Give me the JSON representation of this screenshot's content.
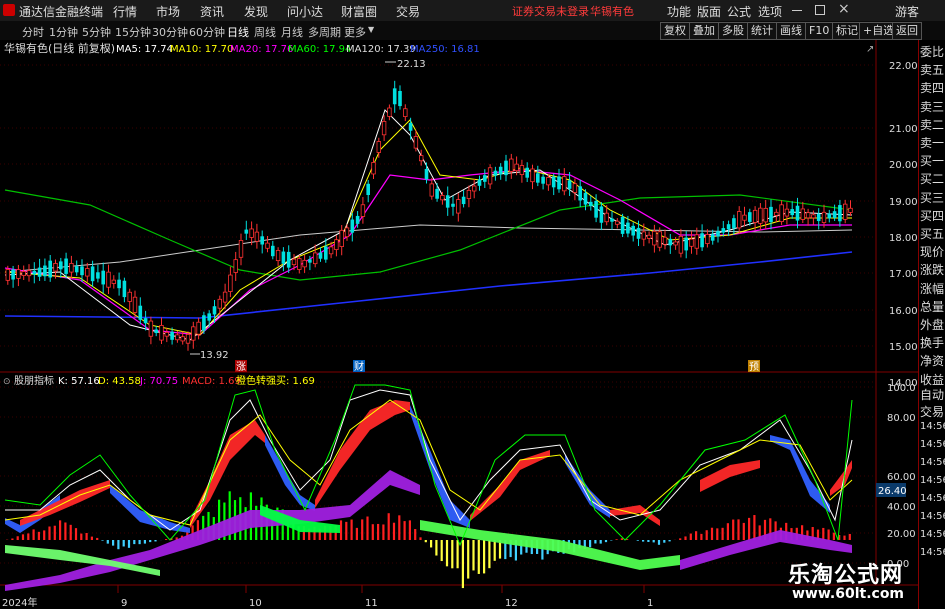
{
  "topbar": {
    "app_title": "通达信金融终端",
    "menu": [
      "行情",
      "市场",
      "资讯",
      "发现",
      "问小达",
      "财富圈",
      "交易"
    ],
    "warning": "证券交易未登录",
    "stock_name": "华锡有色",
    "right_menu": [
      "功能",
      "版面",
      "公式",
      "选项"
    ],
    "guest": "游客"
  },
  "timeframes": {
    "items": [
      "分时",
      "1分钟",
      "5分钟",
      "15分钟",
      "30分钟",
      "60分钟",
      "日线",
      "周线",
      "月线",
      "多周期",
      "更多"
    ],
    "active": "日线"
  },
  "toolbar": {
    "buttons": [
      "复权",
      "叠加",
      "多股",
      "统计",
      "画线",
      "F10",
      "标记",
      "+自选",
      "返回"
    ]
  },
  "main_chart": {
    "title": "华锡有色(日线 前复权)",
    "ma_labels": [
      {
        "text": "MA5: 17.74",
        "color": "#ffffff"
      },
      {
        "text": "MA10: 17.70",
        "color": "#ffff00"
      },
      {
        "text": "MA20: 17.76",
        "color": "#ff00ff"
      },
      {
        "text": "MA60: 17.94",
        "color": "#00ff00"
      },
      {
        "text": "MA120: 17.39",
        "color": "#dddddd"
      },
      {
        "text": "MA250: 16.81",
        "color": "#3050ff"
      }
    ],
    "high_label": "22.13",
    "low_label": "13.92",
    "y_ticks": [
      "22.00",
      "21.00",
      "20.00",
      "19.00",
      "18.00",
      "17.00",
      "16.00",
      "15.00",
      "14.00"
    ],
    "markers": [
      "涨",
      "财",
      "预"
    ]
  },
  "indicator": {
    "name": "股朋指标",
    "values": [
      {
        "text": "K: 57.16",
        "color": "#ffffff"
      },
      {
        "text": "D: 43.58",
        "color": "#ffff00"
      },
      {
        "text": "J: 70.75",
        "color": "#ff00ff"
      },
      {
        "text": "MACD: 1.69",
        "color": "#ff3030"
      },
      {
        "text": "橙色转强买: 1.69",
        "color": "#ffff00"
      }
    ],
    "y_ticks": [
      "100.0",
      "80.00",
      "60.00",
      "40.00",
      "20.00",
      "0.00"
    ],
    "current": "26.40"
  },
  "x_axis": {
    "labels": [
      "2024年",
      "9",
      "10",
      "11",
      "12",
      "1"
    ]
  },
  "side_panel": {
    "quote_labels": [
      "委比",
      "卖五",
      "卖四",
      "卖三",
      "卖二",
      "卖一",
      "买一",
      "买二",
      "买三",
      "买四",
      "买五",
      "现价",
      "涨跌",
      "涨幅",
      "总量",
      "外盘",
      "换手",
      "净资",
      "收益"
    ],
    "auto_trade": [
      "自动",
      "交易"
    ],
    "times": [
      "14:56",
      "14:56",
      "14:56",
      "14:56",
      "14:56",
      "14:56",
      "14:56",
      "14:56"
    ]
  },
  "watermark": {
    "title": "乐淘公式网",
    "url": "www.60lt.com"
  }
}
